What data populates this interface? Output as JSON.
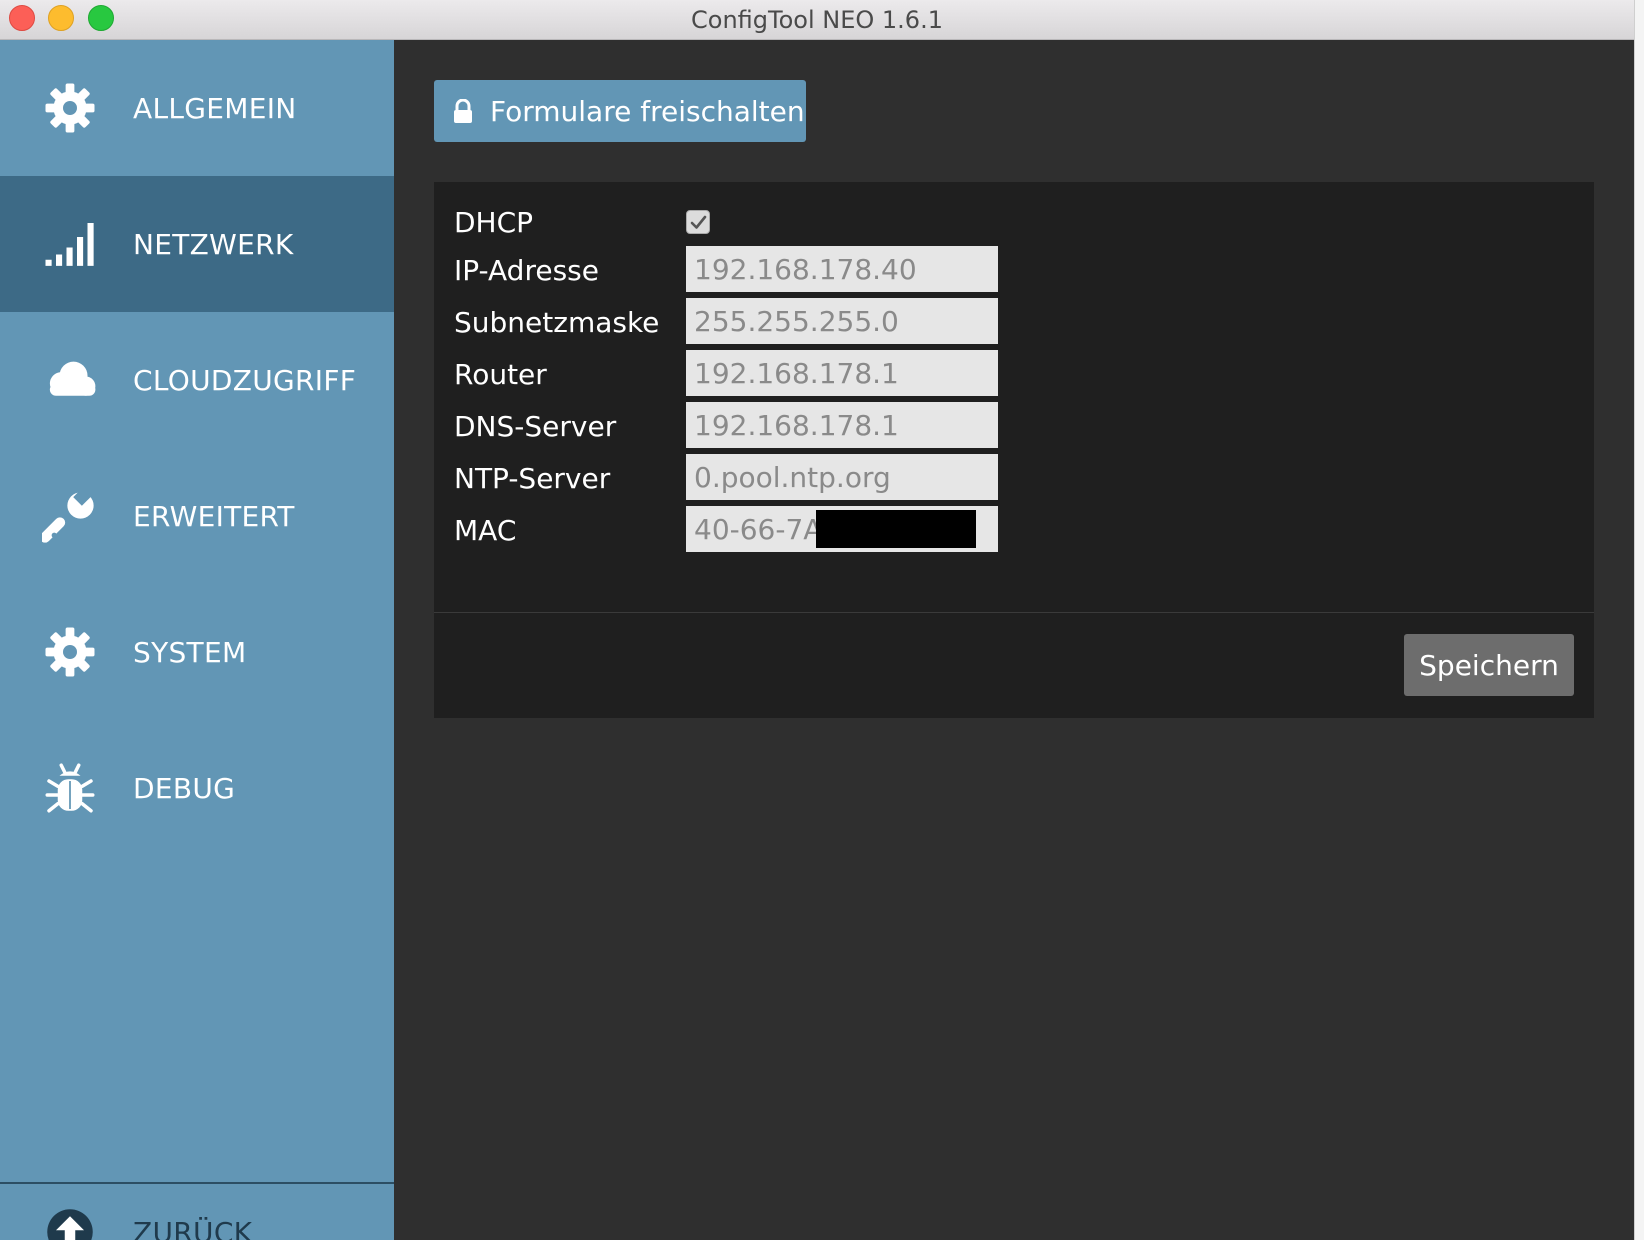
{
  "window": {
    "title": "ConfigTool NEO 1.6.1"
  },
  "sidebar": {
    "items": [
      {
        "label": "ALLGEMEIN",
        "icon": "gear-icon",
        "active": false
      },
      {
        "label": "NETZWERK",
        "icon": "signal-bars-icon",
        "active": true
      },
      {
        "label": "CLOUDZUGRIFF",
        "icon": "cloud-icon",
        "active": false
      },
      {
        "label": "ERWEITERT",
        "icon": "wrench-icon",
        "active": false
      },
      {
        "label": "SYSTEM",
        "icon": "gear-icon",
        "active": false
      },
      {
        "label": "DEBUG",
        "icon": "bug-icon",
        "active": false
      }
    ],
    "back": {
      "label": "ZURÜCK",
      "icon": "arrow-up-circle-icon"
    }
  },
  "toolbar": {
    "unlock_label": "Formulare freischalten"
  },
  "form": {
    "dhcp": {
      "label": "DHCP",
      "checked": true
    },
    "ip": {
      "label": "IP-Adresse",
      "value": "192.168.178.40"
    },
    "subnet": {
      "label": "Subnetzmaske",
      "value": "255.255.255.0"
    },
    "router": {
      "label": "Router",
      "value": "192.168.178.1"
    },
    "dns": {
      "label": "DNS-Server",
      "value": "192.168.178.1"
    },
    "ntp": {
      "label": "NTP-Server",
      "value": "0.pool.ntp.org"
    },
    "mac": {
      "label": "MAC",
      "value": "40-66-7A-"
    },
    "save_label": "Speichern"
  },
  "colors": {
    "sidebar": "#6296b5",
    "sidebar_active": "#3d6a86",
    "content_bg": "#2f2f2f",
    "panel_bg": "#1f1f1f",
    "save_button": "#6d6d6d"
  }
}
